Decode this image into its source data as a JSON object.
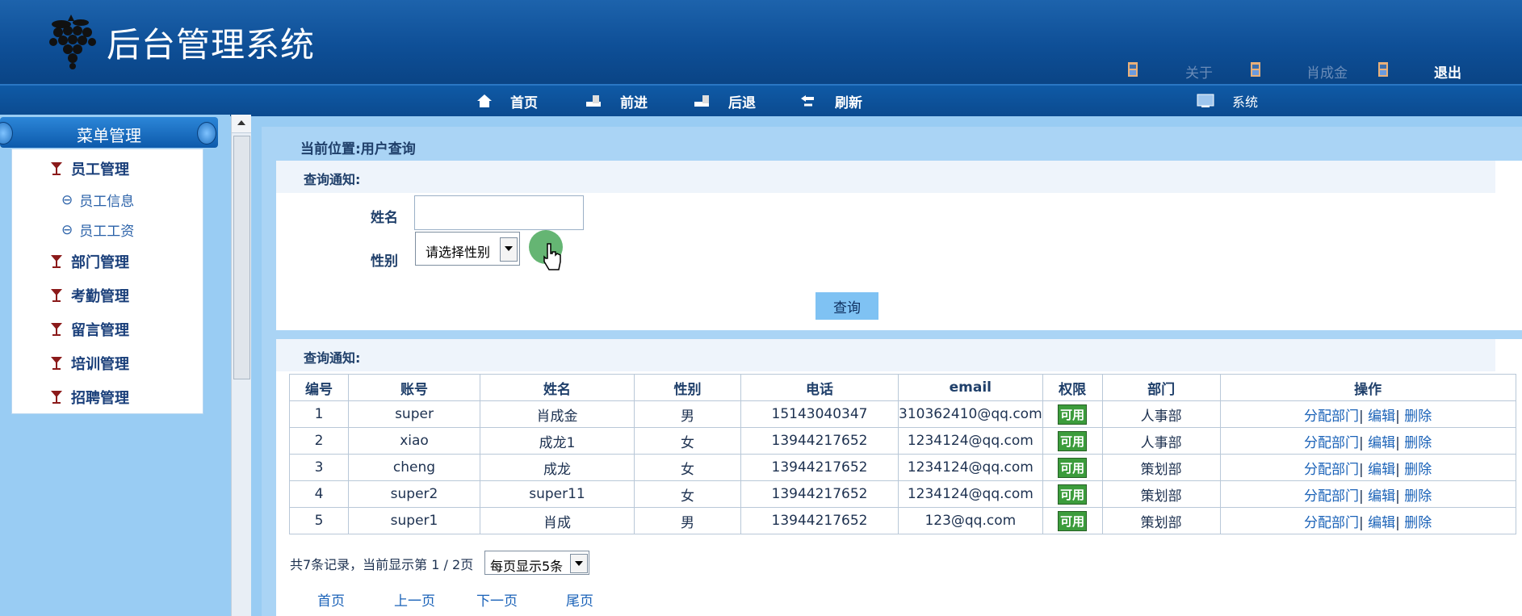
{
  "header": {
    "app_title": "后台管理系统",
    "top_links": [
      {
        "label": "关于",
        "color": "#6a8cb8"
      },
      {
        "label": "肖成金",
        "color": "#6a8cb8"
      },
      {
        "label": "退出",
        "color": "#ffffff"
      }
    ],
    "system_label": "系统"
  },
  "navbar": {
    "items": [
      {
        "label": "首页",
        "icon": "home-icon"
      },
      {
        "label": "前进",
        "icon": "forward-icon"
      },
      {
        "label": "后退",
        "icon": "back-icon"
      },
      {
        "label": "刷新",
        "icon": "refresh-icon"
      }
    ]
  },
  "sidebar": {
    "title": "菜单管理",
    "groups": [
      {
        "label": "员工管理",
        "children": [
          "员工信息",
          "员工工资"
        ]
      },
      {
        "label": "部门管理"
      },
      {
        "label": "考勤管理"
      },
      {
        "label": "留言管理"
      },
      {
        "label": "培训管理"
      },
      {
        "label": "招聘管理"
      }
    ]
  },
  "breadcrumb": "当前位置:用户查询",
  "search_panel": {
    "heading": "查询通知:",
    "name_label": "姓名",
    "name_value": "",
    "gender_label": "性别",
    "gender_selected": "请选择性别",
    "query_button": "查询"
  },
  "results_panel": {
    "heading": "查询通知:",
    "columns": [
      "编号",
      "账号",
      "姓名",
      "性别",
      "电话",
      "email",
      "权限",
      "部门",
      "操作"
    ],
    "rows": [
      [
        "1",
        "super",
        "肖成金",
        "男",
        "15143040347",
        "310362410@qq.com",
        "可用",
        "人事部"
      ],
      [
        "2",
        "xiao",
        "成龙1",
        "女",
        "13944217652",
        "1234124@qq.com",
        "可用",
        "人事部"
      ],
      [
        "3",
        "cheng",
        "成龙",
        "女",
        "13944217652",
        "1234124@qq.com",
        "可用",
        "策划部"
      ],
      [
        "4",
        "super2",
        "super11",
        "女",
        "13944217652",
        "1234124@qq.com",
        "可用",
        "策划部"
      ],
      [
        "5",
        "super1",
        "肖成",
        "男",
        "13944217652",
        "123@qq.com",
        "可用",
        "策划部"
      ]
    ],
    "actions": [
      "分配部门",
      "编辑",
      "删除"
    ],
    "pager_info": "共7条记录，当前显示第 1 / 2页",
    "page_size": "每页显示5条",
    "pager_links": [
      "首页",
      "上一页",
      "下一页",
      "尾页"
    ]
  },
  "colors": {
    "header_bg": "#0e4f97",
    "content_bg": "#aad4f5",
    "badge_green": "#3c9c3c",
    "link_blue": "#1a62b8"
  }
}
